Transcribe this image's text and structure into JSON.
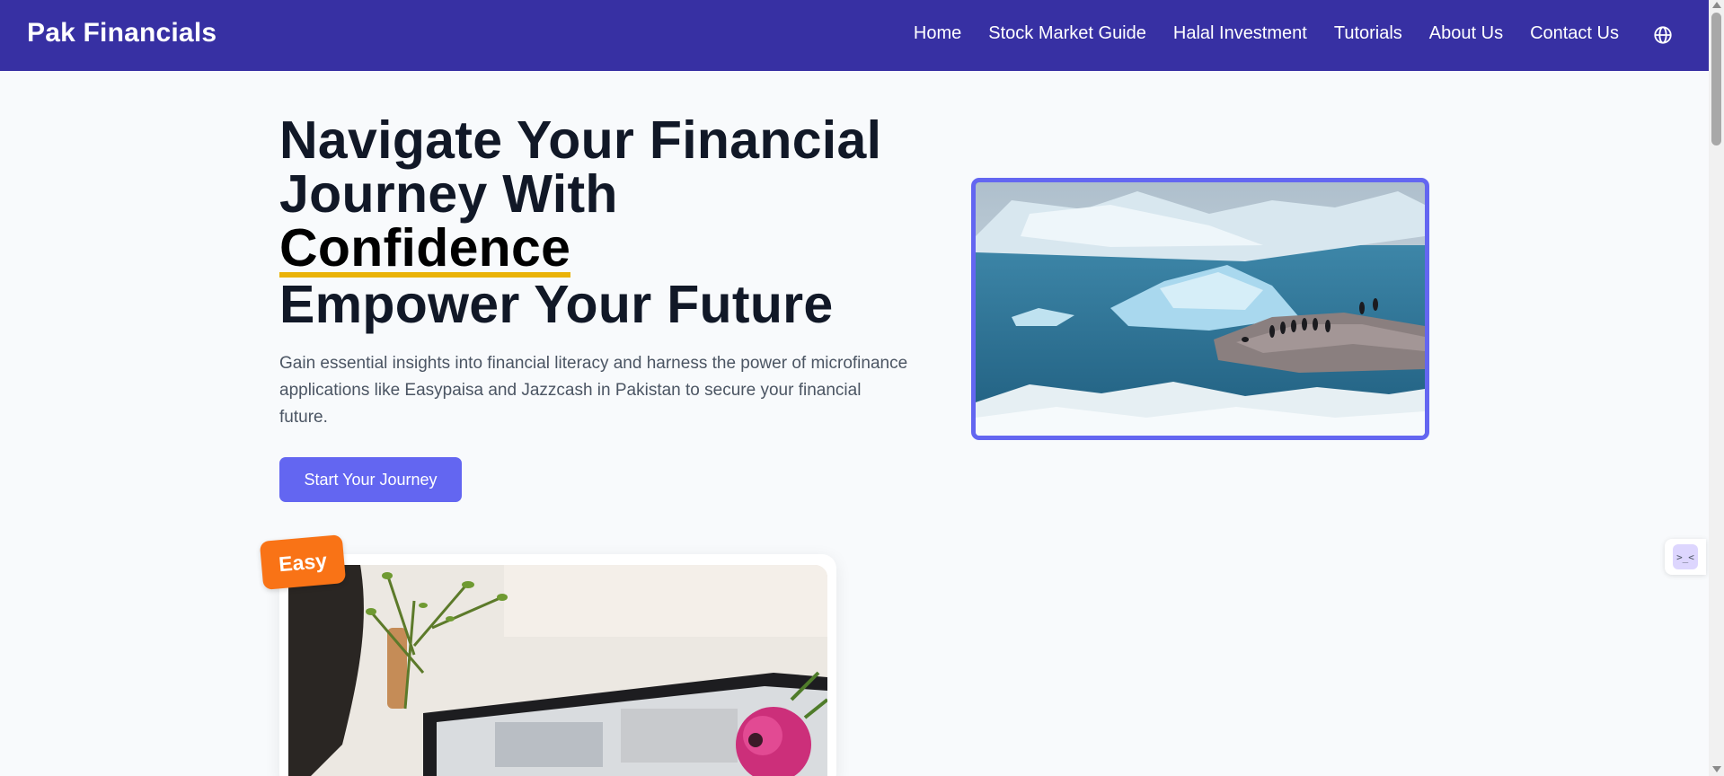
{
  "navbar": {
    "brand": "Pak Financials",
    "links": [
      {
        "label": "Home"
      },
      {
        "label": "Stock Market Guide"
      },
      {
        "label": "Halal Investment"
      },
      {
        "label": "Tutorials"
      },
      {
        "label": "About Us"
      },
      {
        "label": "Contact Us"
      }
    ],
    "language_icon": "globe-icon"
  },
  "hero": {
    "title_line1": "Navigate Your Financial",
    "title_line2": "Journey With",
    "title_highlight": "Confidence",
    "title_line4": "Empower Your Future",
    "description": "Gain essential insights into financial literacy and harness the power of microfinance applications like Easypaisa and Jazzcash in Pakistan to secure your financial future.",
    "cta_label": "Start Your Journey",
    "image_subject": "icebergs-penguins-photo"
  },
  "card": {
    "badge": "Easy",
    "image_subject": "laptop-flowers-photo"
  },
  "widget": {
    "glyph": ">_<"
  },
  "colors": {
    "navbar": "#3730a3",
    "accent": "#6366f1",
    "highlight_underline": "#eab308",
    "badge": "#f97316"
  }
}
